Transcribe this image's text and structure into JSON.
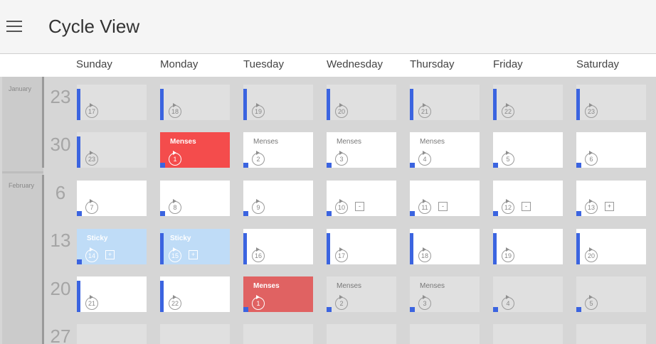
{
  "app": {
    "title": "Cycle View"
  },
  "days": [
    "Sunday",
    "Monday",
    "Tuesday",
    "Wednesday",
    "Thursday",
    "Friday",
    "Saturday"
  ],
  "months": [
    "January",
    "February"
  ],
  "weeks": [
    {
      "num": "23",
      "cells": [
        {
          "n": "17",
          "bg": "gray",
          "mark": "bar"
        },
        {
          "n": "18",
          "bg": "gray",
          "mark": "bar"
        },
        {
          "n": "19",
          "bg": "gray",
          "mark": "bar"
        },
        {
          "n": "20",
          "bg": "gray",
          "mark": "bar"
        },
        {
          "n": "21",
          "bg": "gray",
          "mark": "bar"
        },
        {
          "n": "22",
          "bg": "gray",
          "mark": "bar"
        },
        {
          "n": "23",
          "bg": "gray",
          "mark": "bar"
        }
      ]
    },
    {
      "num": "30",
      "cells": [
        {
          "n": "23",
          "bg": "gray",
          "mark": "bar"
        },
        {
          "n": "1",
          "bg": "red",
          "mark": "dot",
          "label": "Menses"
        },
        {
          "n": "2",
          "bg": "white",
          "mark": "dot",
          "label": "Menses"
        },
        {
          "n": "3",
          "bg": "white",
          "mark": "dot",
          "label": "Menses"
        },
        {
          "n": "4",
          "bg": "white",
          "mark": "dot",
          "label": "Menses"
        },
        {
          "n": "5",
          "bg": "white",
          "mark": "dot"
        },
        {
          "n": "6",
          "bg": "white",
          "mark": "dot"
        }
      ]
    },
    {
      "num": "6",
      "cells": [
        {
          "n": "7",
          "bg": "white",
          "mark": "dot"
        },
        {
          "n": "8",
          "bg": "white",
          "mark": "dot"
        },
        {
          "n": "9",
          "bg": "white",
          "mark": "dot"
        },
        {
          "n": "10",
          "bg": "white",
          "mark": "dot",
          "btn": "-"
        },
        {
          "n": "11",
          "bg": "white",
          "mark": "dot",
          "btn": "-"
        },
        {
          "n": "12",
          "bg": "white",
          "mark": "dot",
          "btn": "-"
        },
        {
          "n": "13",
          "bg": "white",
          "mark": "dot",
          "btn": "+"
        }
      ]
    },
    {
      "num": "13",
      "cells": [
        {
          "n": "14",
          "bg": "blue",
          "mark": "dot",
          "label": "Sticky",
          "btn": "+"
        },
        {
          "n": "15",
          "bg": "blue",
          "mark": "bar",
          "label": "Sticky",
          "btn": "+"
        },
        {
          "n": "16",
          "bg": "white",
          "mark": "bar"
        },
        {
          "n": "17",
          "bg": "white",
          "mark": "bar"
        },
        {
          "n": "18",
          "bg": "white",
          "mark": "bar"
        },
        {
          "n": "19",
          "bg": "white",
          "mark": "bar"
        },
        {
          "n": "20",
          "bg": "white",
          "mark": "bar"
        }
      ]
    },
    {
      "num": "20",
      "cells": [
        {
          "n": "21",
          "bg": "white",
          "mark": "bar"
        },
        {
          "n": "22",
          "bg": "white",
          "mark": "bar"
        },
        {
          "n": "1",
          "bg": "red2",
          "mark": "dot",
          "label": "Menses"
        },
        {
          "n": "2",
          "bg": "gray",
          "mark": "dot",
          "label": "Menses"
        },
        {
          "n": "3",
          "bg": "gray",
          "mark": "dot",
          "label": "Menses"
        },
        {
          "n": "4",
          "bg": "gray",
          "mark": "dot"
        },
        {
          "n": "5",
          "bg": "gray",
          "mark": "dot"
        }
      ]
    },
    {
      "num": "27",
      "cells": []
    }
  ],
  "colors": {
    "accent": "#3b64e0",
    "menses": "#f44c4c",
    "menses_muted": "#e06262",
    "sticky": "#bfdcf7"
  },
  "icons": {
    "menu": "hamburger-menu-icon",
    "cycle_day": "circular-arrow-icon"
  }
}
